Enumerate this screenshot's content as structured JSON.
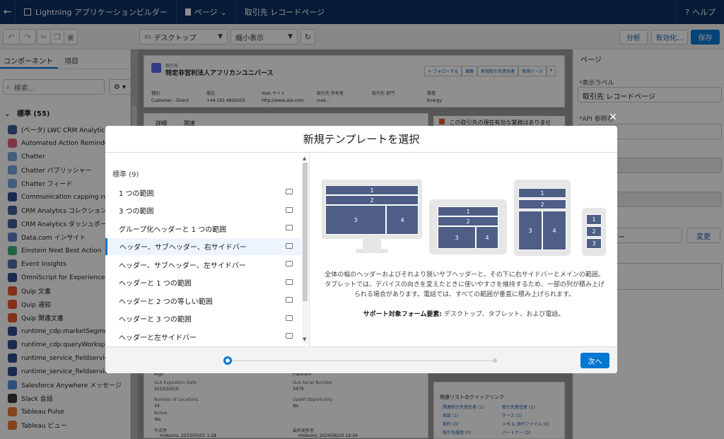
{
  "topbar": {
    "back_icon": "←",
    "app_title": "Lightning アプリケーションビルダー",
    "page_menu": "ページ",
    "page_name": "取引先 レコードページ",
    "help": "ヘルプ"
  },
  "toolbar": {
    "device": "デスクトップ",
    "view": "縮小表示",
    "analyze": "分析",
    "activate": "有効化...",
    "save": "保存"
  },
  "left": {
    "tab_components": "コンポーネント",
    "tab_items": "項目",
    "search_placeholder": "検索...",
    "section": "標準 (55)",
    "items": [
      {
        "label": "(ベータ) LWC CRM Analytics タ",
        "color": "#3b5b9b"
      },
      {
        "label": "Automated Action Reminders",
        "color": "#e25c7a"
      },
      {
        "label": "Chatter",
        "color": "#6fa8dc"
      },
      {
        "label": "Chatter パブリッシャー",
        "color": "#6fa8dc"
      },
      {
        "label": "Chatter フィード",
        "color": "#6fa8dc"
      },
      {
        "label": "Communication capping rules",
        "color": "#2a4a8a"
      },
      {
        "label": "CRM Analytics コレクション",
        "color": "#3b5b9b"
      },
      {
        "label": "CRM Analytics ダッシュボード",
        "color": "#3b5b9b"
      },
      {
        "label": "Data.com インサイト",
        "color": "#5b7fc8"
      },
      {
        "label": "Einstein Next Best Action",
        "color": "#3bb07a"
      },
      {
        "label": "Event Insights",
        "color": "#4a6fa5"
      },
      {
        "label": "OmniScript for Experience Clou",
        "color": "#2a4a8a"
      },
      {
        "label": "Quip 文書",
        "color": "#e8552d"
      },
      {
        "label": "Quip 通知",
        "color": "#e8552d"
      },
      {
        "label": "Quip 関連文書",
        "color": "#e8552d"
      },
      {
        "label": "runtime_cdp:marketSegmentD",
        "color": "#2a4a8a"
      },
      {
        "label": "runtime_cdp:queryWorkspaceC",
        "color": "#2a4a8a"
      },
      {
        "label": "runtime_service_fieldservice:ac",
        "color": "#2a4a8a"
      },
      {
        "label": "runtime_service_fieldservice:worko",
        "color": "#2a4a8a"
      },
      {
        "label": "Salesforce Anywhere メッセージ",
        "color": "#4f8fe0"
      },
      {
        "label": "Slack 会話",
        "color": "#333333"
      },
      {
        "label": "Tableau Pulse",
        "color": "#e8772e"
      },
      {
        "label": "Tableau ビュー",
        "color": "#e8772e"
      }
    ]
  },
  "canvas": {
    "object_label": "取引先",
    "record_name": "特定非営利法人アフリカンユニバース",
    "actions": [
      "+ フォローする",
      "編集",
      "新規取引先責任者",
      "新規ケース"
    ],
    "fields": [
      {
        "label": "種別",
        "value": "Customer - Direct"
      },
      {
        "label": "電話",
        "value": "+44 191 4956203"
      },
      {
        "label": "Web サイト",
        "value": "http://www.uos.com"
      },
      {
        "label": "取引先 所有者",
        "value": "mok..."
      },
      {
        "label": "取引先 部門",
        "value": ""
      },
      {
        "label": "業種",
        "value": "Energy"
      }
    ],
    "tab_detail": "詳細",
    "tab_related": "関連",
    "alert": "この取引先の現在有効な業務はありません。",
    "bottom": {
      "high": "High",
      "platinum": "Platinum",
      "sla_exp_label": "SLA Expiration Date",
      "sla_exp": "2015/10/10",
      "sla_serial_label": "SLA Serial Number",
      "sla_serial": "3479",
      "locations_label": "Number of Locations",
      "locations": "34",
      "upsell_label": "Upsell Opportunity",
      "upsell": "No",
      "active_label": "Active",
      "active": "Yes",
      "created_label": "作成者",
      "created": "mokumo, 2023/03/01 1:28",
      "modified_label": "最終更新者",
      "modified": "mokumo, 2024/06/10 19:34",
      "quicklinks": "関連リストのクイックリンク",
      "links": [
        "関連取引先責任者 (1)",
        "取引先責任者 (1)",
        "商談 (1)",
        "ケース (1)",
        "契約 (0)",
        "メモ & 添付ファイル (0)",
        "取引先履歴 (0)",
        "パートナー (0)"
      ]
    }
  },
  "right": {
    "title": "ページ",
    "label_label": "表示ラベル",
    "label_value": "取引先 レコードページ",
    "api_label": "API 参照名",
    "type_value": "ージ",
    "template_value": "ちサイドバー",
    "change": "変更"
  },
  "modal": {
    "title": "新規テンプレートを選択",
    "category": "標準 (9)",
    "options": [
      "1 つの範囲",
      "3 つの範囲",
      "グループ化ヘッダーと 1 つの範囲",
      "ヘッダー、サブヘッダー、右サイドバー",
      "ヘッダー、サブヘッダー、左サイドバー",
      "ヘッダーと 1 つの範囲",
      "ヘッダーと 2 つの等しい範囲",
      "ヘッダーと 3 つの範囲",
      "ヘッダーと左サイドバー"
    ],
    "selected_index": 3,
    "description": "全体の幅のヘッダーおよびそれより狭いサブヘッダーと、その下に右サイドバーとメインの範囲。タブレットでは、デバイスの向きを変えたときに使いやすさを維持するため、一部の列が積み上げられる場合があります。電話では、すべての範囲が垂直に積み上げられます。",
    "support_label": "サポート対象フォーム要素:",
    "support_value": " デスクトップ、タブレット、および電話。",
    "next": "次へ",
    "blocks": [
      "1",
      "2",
      "3",
      "4"
    ]
  }
}
